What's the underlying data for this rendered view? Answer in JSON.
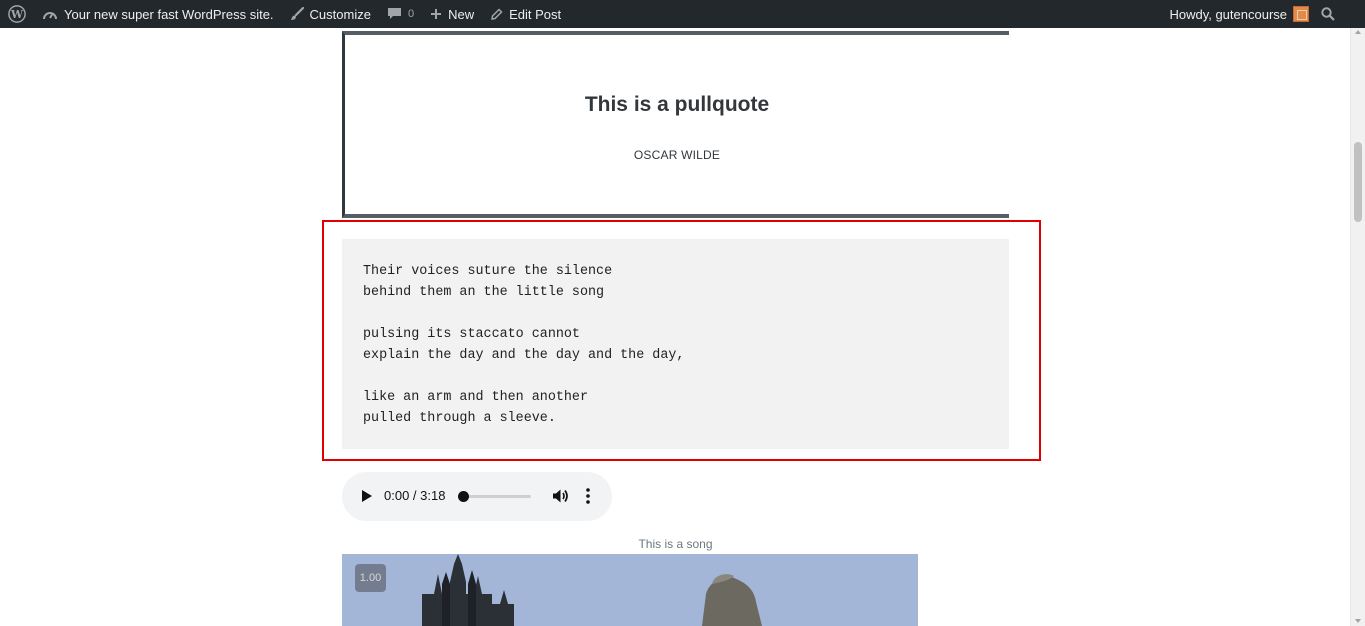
{
  "adminbar": {
    "site_name": "Your new super fast WordPress site.",
    "customize": "Customize",
    "comments_count": "0",
    "new": "New",
    "edit_post": "Edit Post",
    "howdy": "Howdy, gutencourse"
  },
  "pullquote": {
    "text": "This is a pullquote",
    "citation": "OSCAR WILDE"
  },
  "verse": {
    "lines": [
      "Their voices suture the silence",
      "behind them an the little song",
      "",
      "pulsing its staccato cannot",
      "explain the day and the day and the day,",
      "",
      "like an arm and then another",
      "pulled through a sleeve."
    ]
  },
  "audio": {
    "time": "0:00 / 3:18",
    "progress": 0
  },
  "audio_caption": "This is a song",
  "video": {
    "speed": "1.00"
  },
  "colors": {
    "adminbar_bg": "#23282d",
    "highlight": "#e00000",
    "verse_bg": "#f2f2f2"
  }
}
